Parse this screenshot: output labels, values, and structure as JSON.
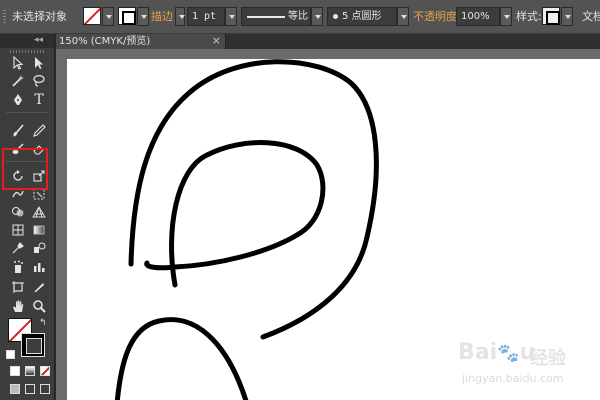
{
  "control_bar": {
    "selection_status": "未选择对象",
    "stroke_label": "描边",
    "stroke_weight": "1 pt",
    "variable_width_profile": "等比",
    "brush_definition": "5 点圆形",
    "opacity_label": "不透明度",
    "opacity_value": "100%",
    "style_label": "样式:",
    "document_setup_label": "文档"
  },
  "document_tab": {
    "title": "150% (CMYK/预览)",
    "close_glyph": "×"
  },
  "toolbar": {
    "collapse_glyph": "◂◂",
    "tools": [
      {
        "name": "selection-tool-icon"
      },
      {
        "name": "direct-selection-tool-icon"
      },
      {
        "name": "magic-wand-tool-icon"
      },
      {
        "name": "lasso-tool-icon"
      },
      {
        "name": "pen-tool-icon"
      },
      {
        "name": "type-tool-icon",
        "glyph": "T"
      },
      {
        "name": "paintbrush-tool-icon"
      },
      {
        "name": "pencil-tool-icon"
      },
      {
        "name": "blob-brush-tool-icon"
      },
      {
        "name": "eraser-tool-icon"
      },
      {
        "name": "rotate-tool-icon"
      },
      {
        "name": "scale-tool-icon"
      },
      {
        "name": "warp-tool-icon"
      },
      {
        "name": "free-transform-tool-icon"
      },
      {
        "name": "shape-builder-tool-icon"
      },
      {
        "name": "perspective-grid-tool-icon"
      },
      {
        "name": "mesh-tool-icon"
      },
      {
        "name": "gradient-tool-icon"
      },
      {
        "name": "eyedropper-tool-icon"
      },
      {
        "name": "blend-tool-icon"
      },
      {
        "name": "symbol-sprayer-tool-icon"
      },
      {
        "name": "column-graph-tool-icon"
      },
      {
        "name": "artboard-tool-icon"
      },
      {
        "name": "slice-tool-icon"
      },
      {
        "name": "hand-tool-icon"
      },
      {
        "name": "zoom-tool-icon"
      }
    ],
    "highlighted_tool": "paintbrush-tool-icon"
  },
  "watermark": {
    "brand": "Bai",
    "brand_suffix": "u",
    "chinese": "经验",
    "url": "jingyan.baidu.com"
  },
  "colors": {
    "fill": "none",
    "stroke": "#000000",
    "highlight_box": "#e81c1c",
    "accent_label": "#e8a04c"
  }
}
